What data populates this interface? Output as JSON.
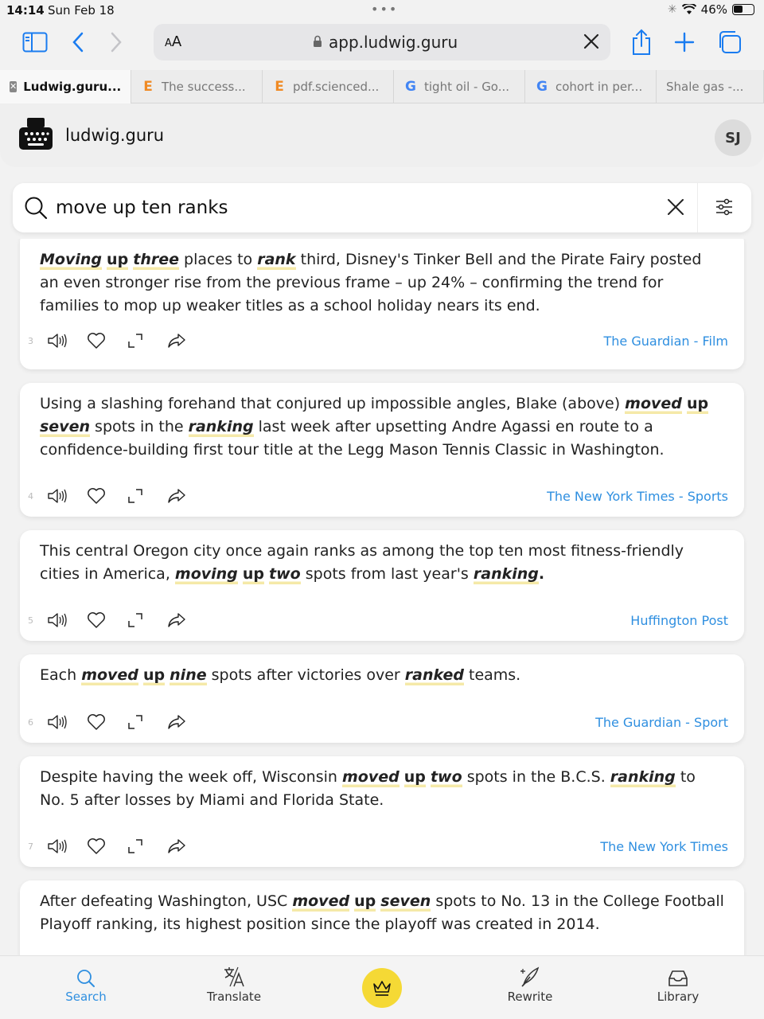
{
  "status": {
    "time": "14:14",
    "date": "Sun Feb 18",
    "battery": "46%",
    "battery_level": 0.46
  },
  "browser": {
    "aa": "AA",
    "url": "app.ludwig.guru",
    "tabs": [
      {
        "label": "Ludwig.guru...",
        "icon": "close-icon",
        "active": true
      },
      {
        "label": "The success...",
        "icon": "E"
      },
      {
        "label": "pdf.scienced...",
        "icon": "E"
      },
      {
        "label": "tight oil - Go...",
        "icon": "G"
      },
      {
        "label": "cohort in per...",
        "icon": "G"
      },
      {
        "label": "Shale gas -...",
        "icon": ""
      }
    ]
  },
  "app": {
    "brand": "ludwig.guru",
    "avatar": "SJ"
  },
  "search": {
    "query": "move up ten ranks"
  },
  "results": [
    {
      "num": "3",
      "parts": [
        {
          "t": "Moving",
          "s": "bi",
          "h": true
        },
        {
          "t": " "
        },
        {
          "t": "up",
          "s": "b",
          "h": true
        },
        {
          "t": " "
        },
        {
          "t": "three",
          "s": "bi",
          "h": true
        },
        {
          "t": " places to "
        },
        {
          "t": "rank",
          "s": "bi",
          "h": true
        },
        {
          "t": " third, Disney's Tinker Bell and the Pirate Fairy posted an even stronger rise from the previous frame – up 24% – confirming the trend for families to mop up weaker titles as a school holiday nears its end."
        }
      ],
      "source": "The Guardian - Film"
    },
    {
      "num": "4",
      "parts": [
        {
          "t": "Using a slashing forehand that conjured up impossible angles, Blake (above) "
        },
        {
          "t": "moved",
          "s": "bi",
          "h": true
        },
        {
          "t": " "
        },
        {
          "t": "up",
          "s": "b",
          "h": true
        },
        {
          "t": " "
        },
        {
          "t": "seven",
          "s": "bi",
          "h": true
        },
        {
          "t": " spots in the "
        },
        {
          "t": "ranking",
          "s": "bi",
          "h": true
        },
        {
          "t": " last week after upsetting Andre Agassi en route to a confidence-building first tour title at the Legg Mason Tennis Classic in Washington."
        }
      ],
      "source": "The New York Times - Sports"
    },
    {
      "num": "5",
      "parts": [
        {
          "t": "This central Oregon city once again ranks as among the top ten most fitness-friendly cities in America, "
        },
        {
          "t": "moving",
          "s": "bi",
          "h": true
        },
        {
          "t": " "
        },
        {
          "t": "up",
          "s": "b",
          "h": true
        },
        {
          "t": " "
        },
        {
          "t": "two",
          "s": "bi",
          "h": true
        },
        {
          "t": " spots from last year's "
        },
        {
          "t": "ranking",
          "s": "bi",
          "h": true
        },
        {
          "t": ".",
          "s": "b"
        }
      ],
      "source": "Huffington Post"
    },
    {
      "num": "6",
      "parts": [
        {
          "t": "Each "
        },
        {
          "t": "moved",
          "s": "bi",
          "h": true
        },
        {
          "t": " "
        },
        {
          "t": "up",
          "s": "b",
          "h": true
        },
        {
          "t": " "
        },
        {
          "t": "nine",
          "s": "bi",
          "h": true
        },
        {
          "t": " spots after victories over "
        },
        {
          "t": "ranked",
          "s": "bi",
          "h": true
        },
        {
          "t": " teams."
        }
      ],
      "source": "The Guardian - Sport"
    },
    {
      "num": "7",
      "parts": [
        {
          "t": "Despite having the week off, Wisconsin "
        },
        {
          "t": "moved",
          "s": "bi",
          "h": true
        },
        {
          "t": " "
        },
        {
          "t": "up",
          "s": "b",
          "h": true
        },
        {
          "t": " "
        },
        {
          "t": "two",
          "s": "bi",
          "h": true
        },
        {
          "t": " spots in the B.C.S. "
        },
        {
          "t": "ranking",
          "s": "bi",
          "h": true
        },
        {
          "t": " to No. 5 after losses by Miami and Florida State."
        }
      ],
      "source": "The New York Times"
    },
    {
      "num": "",
      "parts": [
        {
          "t": "After defeating Washington, USC "
        },
        {
          "t": "moved",
          "s": "bi",
          "h": true
        },
        {
          "t": " "
        },
        {
          "t": "up",
          "s": "b",
          "h": true
        },
        {
          "t": " "
        },
        {
          "t": "seven",
          "s": "bi",
          "h": true
        },
        {
          "t": " spots to No. 13 in the College Football Playoff ranking, its highest position since the playoff was created in 2014."
        }
      ],
      "source": ""
    }
  ],
  "nav": [
    {
      "label": "Search",
      "icon": "search-icon",
      "active": true
    },
    {
      "label": "Translate",
      "icon": "translate-icon"
    },
    {
      "label": "",
      "icon": "crown-icon"
    },
    {
      "label": "Rewrite",
      "icon": "rewrite-icon"
    },
    {
      "label": "Library",
      "icon": "library-icon"
    }
  ],
  "colors": {
    "accent": "#2f8fe0",
    "highlight": "#f5e9a8",
    "crown": "#f5d935",
    "browser_blue": "#1a7cf0"
  }
}
